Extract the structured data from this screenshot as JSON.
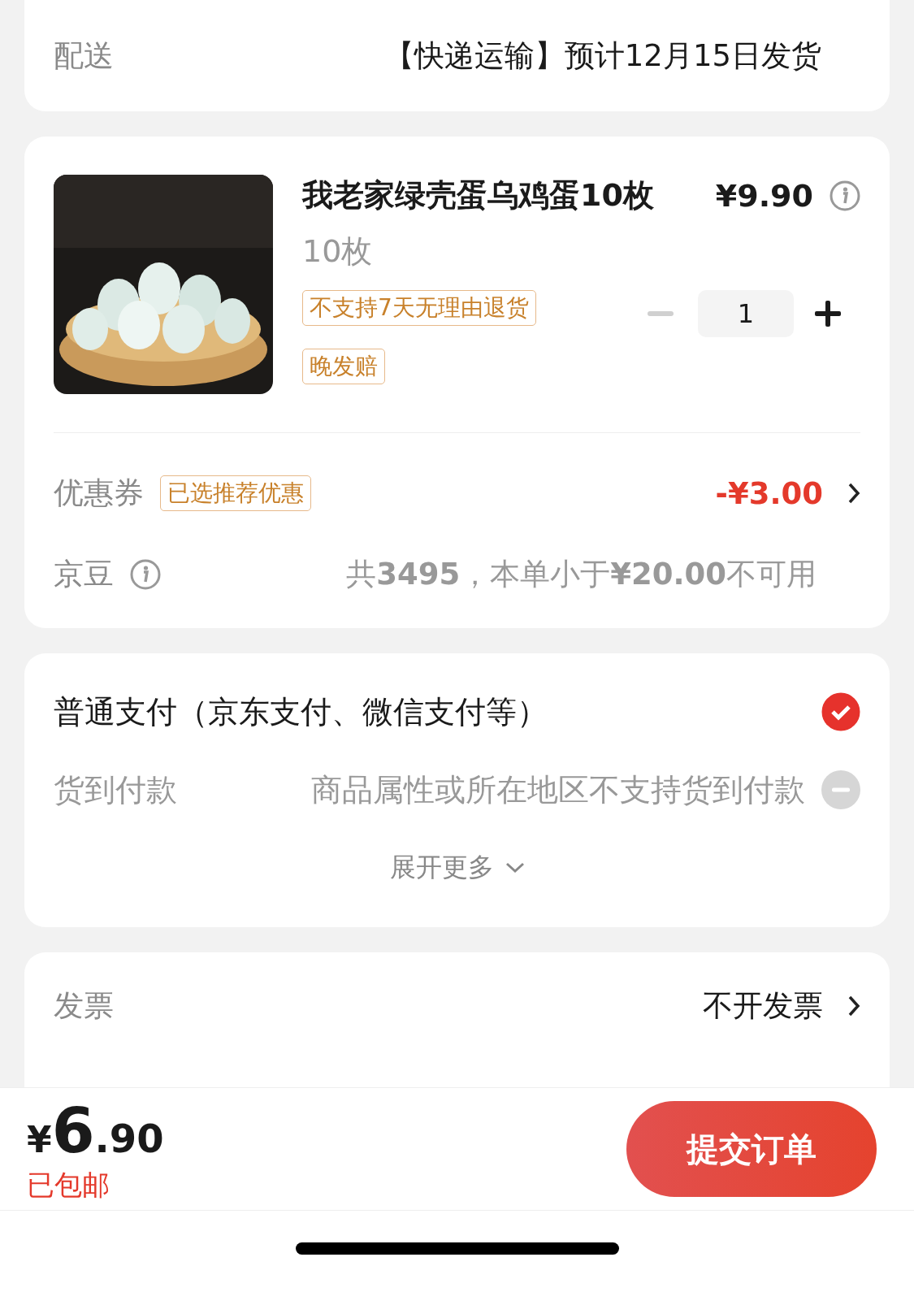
{
  "delivery": {
    "label": "配送",
    "value": "【快递运输】预计12月15日发货"
  },
  "product": {
    "title": "我老家绿壳蛋乌鸡蛋10枚",
    "price": "¥9.90",
    "spec": "10枚",
    "tags": [
      "不支持7天无理由退货",
      "晚发赔"
    ],
    "quantity": "1",
    "decrease_disabled": true
  },
  "coupon": {
    "label": "优惠券",
    "badge": "已选推荐优惠",
    "value": "-¥3.00"
  },
  "beans": {
    "label": "京豆",
    "text": "共**3495**，本单小于**¥20.00**不可用"
  },
  "payment": {
    "options": [
      {
        "label": "普通支付（京东支付、微信支付等）",
        "selected": true,
        "disabled": false
      },
      {
        "label": "货到付款",
        "note": "商品属性或所在地区不支持货到付款",
        "selected": false,
        "disabled": true
      }
    ],
    "expand": "展开更多"
  },
  "invoice": {
    "label": "发票",
    "value": "不开发票"
  },
  "footer": {
    "currency": "¥",
    "integer": "6",
    "decimal": ".90",
    "shipping": "已包邮",
    "submit": "提交订单"
  }
}
